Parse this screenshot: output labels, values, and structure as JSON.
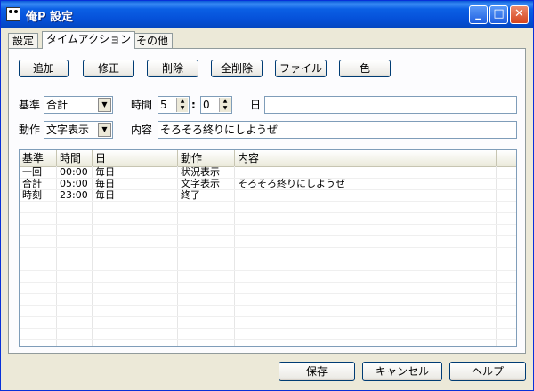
{
  "window": {
    "title": "俺P  設定"
  },
  "tabs": [
    "設定",
    "タイムアクション",
    "その他"
  ],
  "toolbar": {
    "add": "追加",
    "edit": "修正",
    "delete": "削除",
    "delete_all": "全削除",
    "file": "ファイル",
    "color": "色"
  },
  "form": {
    "base_label": "基準",
    "base_value": "合計",
    "time_label": "時間",
    "hour": "5",
    "colon": ":",
    "minute": "0",
    "day_label": "日",
    "day_value": "",
    "action_label": "動作",
    "action_value": "文字表示",
    "content_label": "内容",
    "content_value": "そろそろ終りにしようぜ"
  },
  "list": {
    "columns": [
      "基準",
      "時間",
      "日",
      "動作",
      "内容"
    ],
    "rows": [
      [
        "一回",
        "00:00",
        "毎日",
        "状況表示",
        ""
      ],
      [
        "合計",
        "05:00",
        "毎日",
        "文字表示",
        "そろそろ終りにしようぜ"
      ],
      [
        "時刻",
        "23:00",
        "毎日",
        "終了",
        ""
      ]
    ]
  },
  "footer": {
    "save": "保存",
    "cancel": "キャンセル",
    "help": "ヘルプ"
  },
  "icons": {
    "minimize": "minimize-icon",
    "maximize": "maximize-icon",
    "close": "close-icon",
    "spin": "spin-arrows-icon",
    "dropdown": "chevron-down-icon"
  }
}
